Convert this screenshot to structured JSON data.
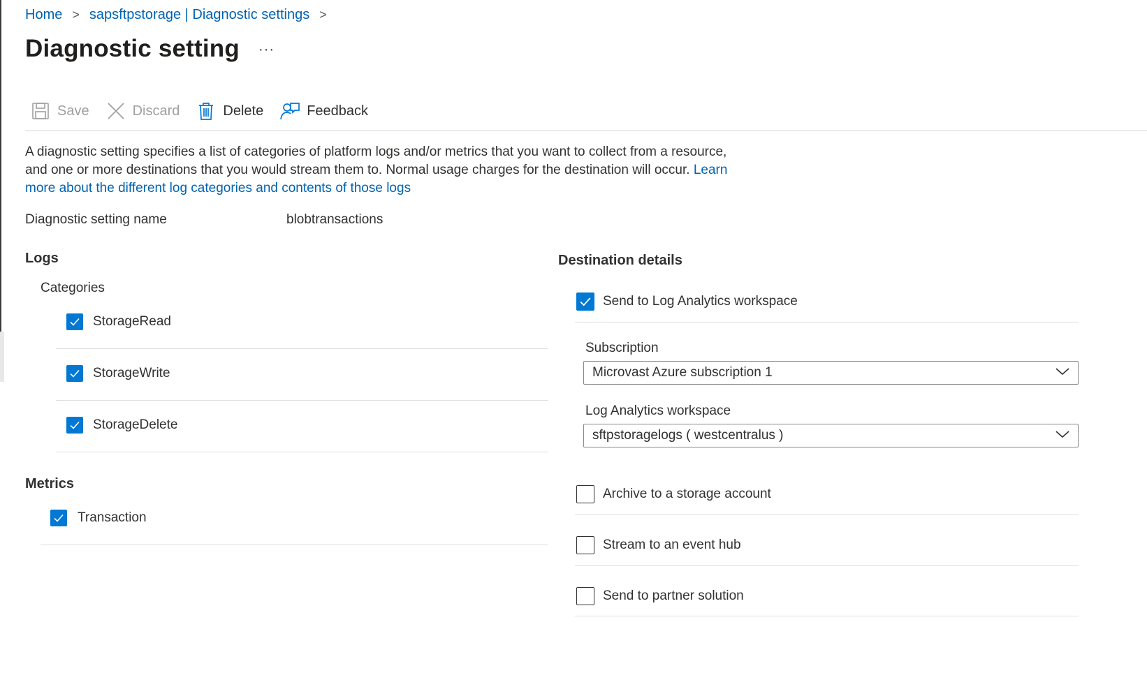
{
  "breadcrumb": {
    "items": [
      "Home",
      "sapsftpstorage | Diagnostic settings"
    ],
    "separator": ">"
  },
  "page_title": "Diagnostic setting",
  "more_menu": "···",
  "toolbar": {
    "save_label": "Save",
    "discard_label": "Discard",
    "delete_label": "Delete",
    "feedback_label": "Feedback"
  },
  "description": {
    "text": "A diagnostic setting specifies a list of categories of platform logs and/or metrics that you want to collect from a resource, and one or more destinations that you would stream them to. Normal usage charges for the destination will occur.",
    "link": "Learn more about the different log categories and contents of those logs"
  },
  "setting_name": {
    "label": "Diagnostic setting name",
    "value": "blobtransactions"
  },
  "logs": {
    "heading": "Logs",
    "categories_label": "Categories",
    "items": [
      {
        "label": "StorageRead",
        "checked": true
      },
      {
        "label": "StorageWrite",
        "checked": true
      },
      {
        "label": "StorageDelete",
        "checked": true
      }
    ]
  },
  "metrics": {
    "heading": "Metrics",
    "items": [
      {
        "label": "Transaction",
        "checked": true
      }
    ]
  },
  "destination": {
    "heading": "Destination details",
    "log_analytics": {
      "label": "Send to Log Analytics workspace",
      "checked": true
    },
    "subscription": {
      "label": "Subscription",
      "value": "Microvast Azure subscription 1"
    },
    "workspace": {
      "label": "Log Analytics workspace",
      "value": "sftpstoragelogs ( westcentralus )"
    },
    "archive": {
      "label": "Archive to a storage account",
      "checked": false
    },
    "event_hub": {
      "label": "Stream to an event hub",
      "checked": false
    },
    "partner": {
      "label": "Send to partner solution",
      "checked": false
    }
  },
  "colors": {
    "accent": "#0078d4",
    "link": "#0063b1",
    "text": "#323130",
    "disabled": "#a19f9d"
  }
}
